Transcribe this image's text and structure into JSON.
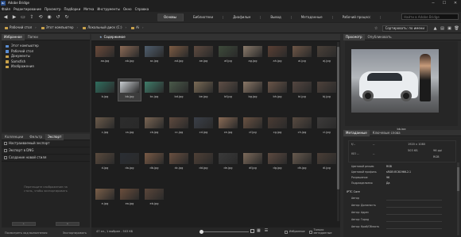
{
  "app": {
    "title": "Adobe Bridge",
    "logo_text": "Br"
  },
  "window": {
    "minimize": "─",
    "maximize": "☐",
    "close": "✕"
  },
  "menu": [
    "Файл",
    "Редактирование",
    "Просмотр",
    "Подборки",
    "Метка",
    "Инструменты",
    "Окно",
    "Справка"
  ],
  "workspaces": {
    "items": [
      "Основы",
      "Библиотеки",
      "Диафильм",
      "Вывод",
      "Метаданные",
      "Рабочий процесс"
    ],
    "active": 0
  },
  "search": {
    "placeholder": "Найти в Adobe Bridge"
  },
  "path": {
    "crumbs": [
      "Рабочий стол",
      "Этот компьютер",
      "Локальный диск (C:)",
      "Ai"
    ],
    "sort_label": "Сортировать: по имени"
  },
  "left": {
    "tabs": [
      "Избранное",
      "Папки"
    ],
    "favorites": [
      {
        "label": "Этот компьютер",
        "icon": "computer-icon",
        "color": "#5b8fd6"
      },
      {
        "label": "Рабочий стол",
        "icon": "desktop-icon",
        "color": "#5b8fd6"
      },
      {
        "label": "Документы",
        "icon": "documents-icon",
        "color": "#c9a24b"
      },
      {
        "label": "Samsfish",
        "icon": "folder-icon",
        "color": "#c9a24b"
      },
      {
        "label": "Изображения",
        "icon": "pictures-icon",
        "color": "#c9a24b"
      }
    ],
    "bottom_tabs": [
      "Коллекции",
      "Фильтр",
      "Экспорт"
    ],
    "export_items": [
      "Настраиваемый экспорт",
      "Экспорт в DNG",
      "Создание новой стиля"
    ],
    "drop_hint_1": "Перетащите изображение на",
    "drop_hint_2": "стиль, чтобы экспортировать",
    "status_left": "Посмотреть ход выполнения",
    "status_right": "Экспортировать"
  },
  "content": {
    "tab": "Содержимое",
    "files": [
      "aa.jpg",
      "ab.jpg",
      "ac.jpg",
      "ad.jpg",
      "ae.jpg",
      "af.jpg",
      "ag.jpg",
      "ah.jpg",
      "ai.jpg",
      "aj.jpg",
      "b.jpg",
      "bb.jpg",
      "bc.jpg",
      "bd.jpg",
      "be.jpg",
      "bf.jpg",
      "bg.jpg",
      "bh.jpg",
      "bi.jpg",
      "bj.jpg",
      "c.jpg",
      "ca.jpg",
      "cb.jpg",
      "cc.jpg",
      "cd.jpg",
      "ce.jpg",
      "cf.jpg",
      "cg.jpg",
      "ch.jpg",
      "ci.jpg",
      "d.jpg",
      "da.jpg",
      "db.jpg",
      "dc.jpg",
      "dd.jpg",
      "de.jpg",
      "df.jpg",
      "dg.jpg",
      "dh.jpg",
      "di.jpg",
      "e.jpg",
      "ea.jpg",
      "eb.jpg"
    ],
    "selected_index": 11,
    "status": "47 эл., 1 выбран - 503 КБ",
    "checkbox_1": "Избранное",
    "checkbox_2": "Только метаданные"
  },
  "right": {
    "tabs": [
      "Просмотр",
      "Опубликовать"
    ],
    "preview_label": "bb.jpg",
    "meta_tabs": [
      "Метаданные",
      "Ключевые слова"
    ],
    "cam": {
      "f": "f/--",
      "shutter": "--",
      "iso": "ISO --",
      "ev": "--",
      "dims": "1920 x 1080",
      "size": "503 КБ",
      "dpi": "96 ppi",
      "mode": "RGB"
    },
    "rows": [
      {
        "k": "Цветовой режим",
        "v": "RGB"
      },
      {
        "k": "Цветовой профиль",
        "v": "sRGB IEC61966-2.1"
      },
      {
        "k": "Разрешение",
        "v": "96"
      },
      {
        "k": "Подразделяемо",
        "v": "Да"
      }
    ],
    "iptc_head": "IPTC Core",
    "iptc_rows": [
      "Автор",
      "Автор: Должность",
      "Автор: Адрес",
      "Автор: Город",
      "Автор: Край/Область"
    ]
  },
  "thumb_colors": [
    "#6b4a3a",
    "#8c6a55",
    "#4f5e6e",
    "#7d5b43",
    "#5e4a3f",
    "#3d4a3a",
    "#8a7a6a",
    "#5a3f33",
    "#6e5646",
    "#4a4038",
    "#2f6e5e",
    "#c8ccd0",
    "#3f7d6a",
    "#4a5a4a",
    "#7a6a55",
    "#5f4f46",
    "#8a7766",
    "#6a5548",
    "#544640",
    "#4e423b",
    "#6b5a4a",
    "#2c2c2c",
    "#7a6553",
    "#5f4a3e",
    "#3a3f48",
    "#8a6b55",
    "#6a5242",
    "#4a3b33",
    "#584a40",
    "#3d3b3a",
    "#5a4a3d",
    "#2a2e34",
    "#7a5a45",
    "#6a5040",
    "#4f4036",
    "#3a3a3a",
    "#7d6a5a",
    "#5d4a40",
    "#685a4e",
    "#4a3e36",
    "#7a5e48",
    "#6b4e3c",
    "#5a463a"
  ]
}
